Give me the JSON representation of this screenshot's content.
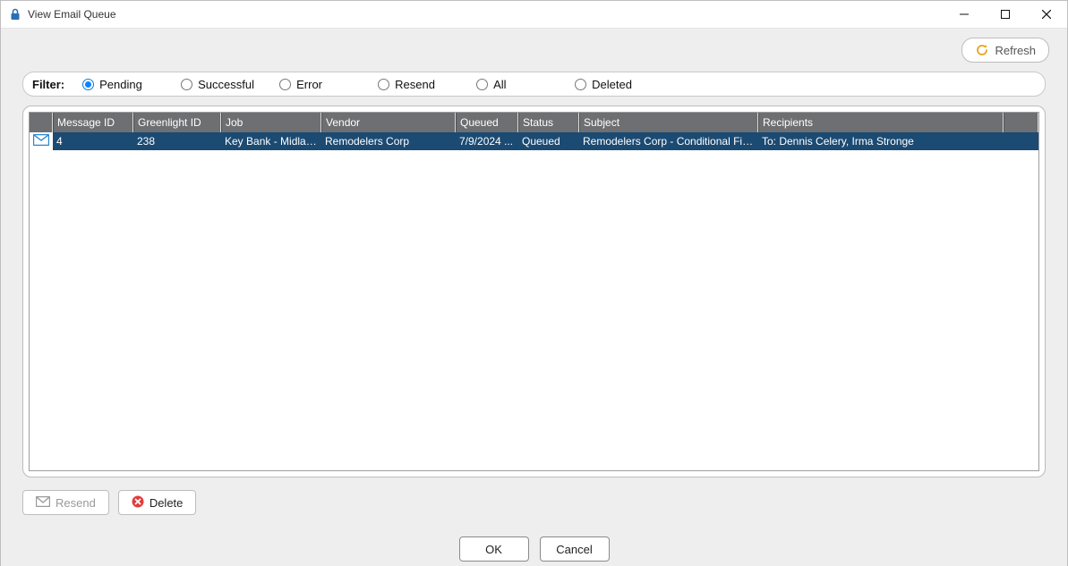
{
  "window": {
    "title": "View Email Queue"
  },
  "toolbar": {
    "refresh_label": "Refresh"
  },
  "filter": {
    "label": "Filter:",
    "options": [
      {
        "id": "pending",
        "label": "Pending",
        "selected": true
      },
      {
        "id": "successful",
        "label": "Successful",
        "selected": false
      },
      {
        "id": "error",
        "label": "Error",
        "selected": false
      },
      {
        "id": "resend",
        "label": "Resend",
        "selected": false
      },
      {
        "id": "all",
        "label": "All",
        "selected": false
      },
      {
        "id": "deleted",
        "label": "Deleted",
        "selected": false
      }
    ]
  },
  "grid": {
    "columns": [
      {
        "id": "icon",
        "label": ""
      },
      {
        "id": "message_id",
        "label": "Message ID"
      },
      {
        "id": "greenlight",
        "label": "Greenlight ID"
      },
      {
        "id": "job",
        "label": "Job"
      },
      {
        "id": "vendor",
        "label": "Vendor"
      },
      {
        "id": "queued",
        "label": "Queued"
      },
      {
        "id": "status",
        "label": "Status"
      },
      {
        "id": "subject",
        "label": "Subject"
      },
      {
        "id": "recipients",
        "label": "Recipients"
      }
    ],
    "rows": [
      {
        "icon": "envelope-icon",
        "message_id": "4",
        "greenlight": "238",
        "job": "Key Bank - Midland",
        "vendor": "Remodelers Corp",
        "queued": "7/9/2024 ...",
        "status": "Queued",
        "subject": "Remodelers Corp - Conditional Final W...",
        "recipients": "To: Dennis Celery, Irma Stronge",
        "selected": true
      }
    ]
  },
  "actions": {
    "resend_label": "Resend",
    "delete_label": "Delete"
  },
  "dialog": {
    "ok_label": "OK",
    "cancel_label": "Cancel"
  }
}
